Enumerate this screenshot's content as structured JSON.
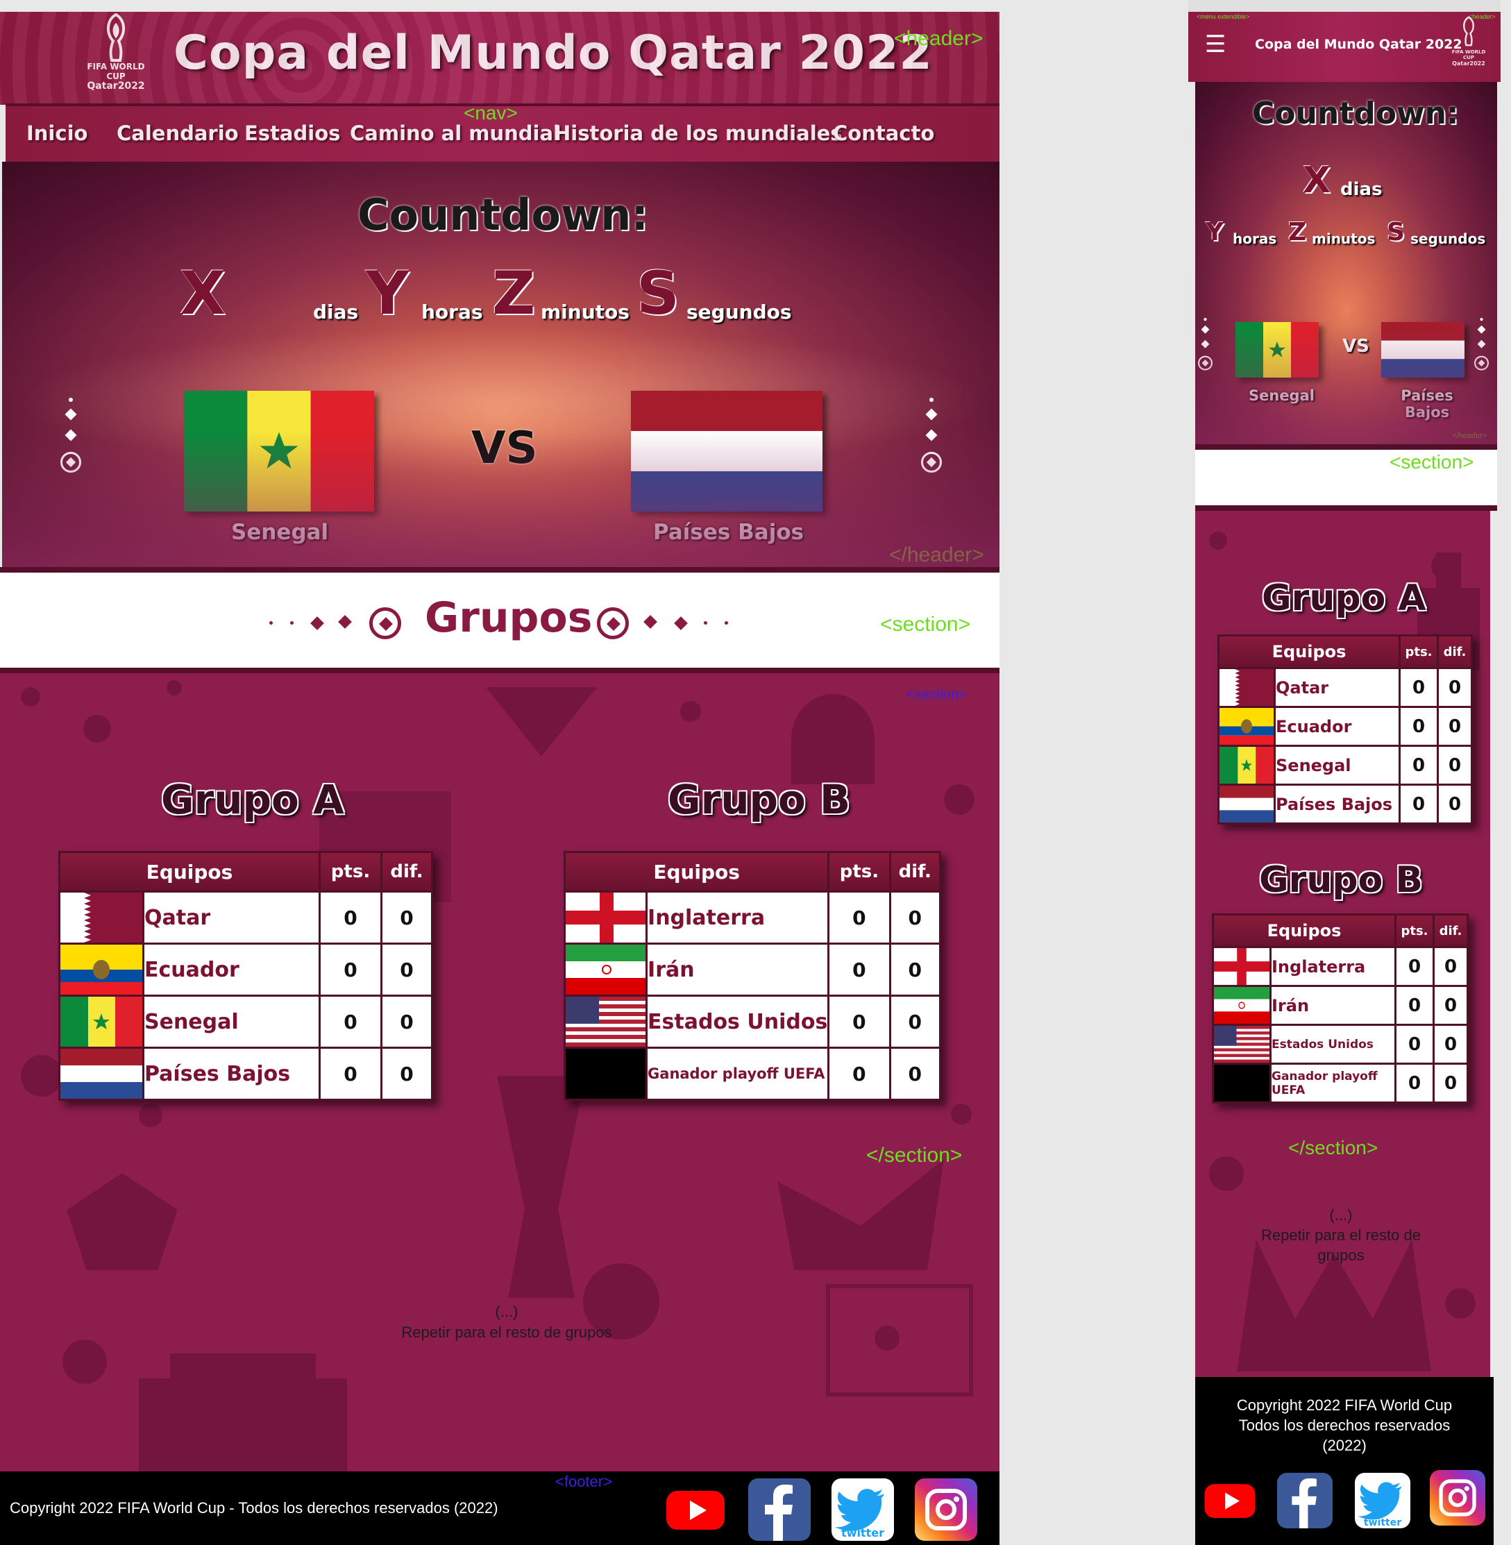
{
  "header": {
    "title": "Copa del Mundo Qatar 2022",
    "logo_line1": "FIFA WORLD CUP",
    "logo_line2": "Qatar2022"
  },
  "nav": {
    "items": [
      "Inicio",
      "Calendario",
      "Estadios",
      "Camino al mundial",
      "Historia de los mundiales",
      "Contacto"
    ]
  },
  "countdown": {
    "title": "Countdown:",
    "days_value": "X",
    "days_label": "dias",
    "hours_value": "Y",
    "hours_label": "horas",
    "minutes_value": "Z",
    "minutes_label": "minutos",
    "seconds_value": "S",
    "seconds_label": "segundos"
  },
  "match": {
    "team1": "Senegal",
    "vs": "VS",
    "team2": "Países Bajos",
    "team2_mobile_line1": "Países",
    "team2_mobile_line2": "Bajos"
  },
  "groups_section": {
    "title": "Grupos"
  },
  "groups": [
    {
      "title": "Grupo A",
      "headers": [
        "Equipos",
        "pts.",
        "dif."
      ],
      "rows": [
        {
          "team": "Qatar",
          "flag": "qatar",
          "pts": "0",
          "dif": "0"
        },
        {
          "team": "Ecuador",
          "flag": "ecuador",
          "pts": "0",
          "dif": "0"
        },
        {
          "team": "Senegal",
          "flag": "senegal",
          "pts": "0",
          "dif": "0"
        },
        {
          "team": "Países Bajos",
          "flag": "netherlands",
          "pts": "0",
          "dif": "0"
        }
      ]
    },
    {
      "title": "Grupo B",
      "headers": [
        "Equipos",
        "pts.",
        "dif."
      ],
      "rows": [
        {
          "team": "Inglaterra",
          "flag": "england",
          "pts": "0",
          "dif": "0"
        },
        {
          "team": "Irán",
          "flag": "iran",
          "pts": "0",
          "dif": "0"
        },
        {
          "team": "Estados Unidos",
          "flag": "usa",
          "pts": "0",
          "dif": "0"
        },
        {
          "team": "Ganador playoff UEFA",
          "flag": "black",
          "pts": "0",
          "dif": "0"
        }
      ]
    }
  ],
  "repeat_note": {
    "ellipsis": "(...)",
    "text": "Repetir para el resto de grupos"
  },
  "footer": {
    "copyright": "Copyright 2022 FIFA World Cup - Todos los derechos reservados (2022)",
    "copyright_mobile_line1": "Copyright  2022 FIFA World Cup",
    "copyright_mobile_line2": "Todos los derechos reservados",
    "copyright_mobile_line3": "(2022)",
    "social_icons": [
      "youtube-icon",
      "facebook-icon",
      "twitter-icon",
      "instagram-icon"
    ],
    "twitter_word": "twitter"
  },
  "annotations": {
    "header": "<header>",
    "header_end": "</header>",
    "nav": "<nav>",
    "section": "<section>",
    "section_end": "</section>",
    "footer": "<footer>",
    "menu_extendible": "<menu extendible>"
  },
  "colors": {
    "primary": "#8a1a42",
    "dark": "#54102a",
    "background": "#8c1d4c",
    "annotation_green": "#6fdc1f",
    "annotation_blue": "#3a1fe0"
  }
}
